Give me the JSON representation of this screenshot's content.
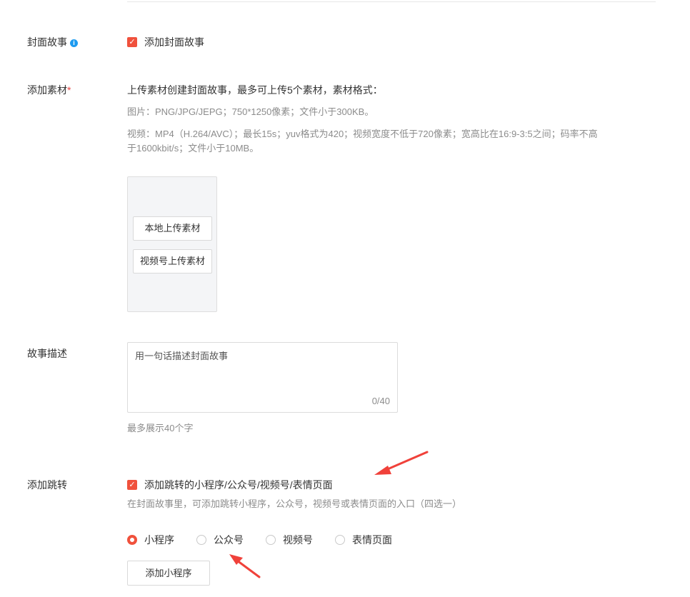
{
  "cover_story": {
    "label": "封面故事",
    "info_icon": "i",
    "checkbox_label": "添加封面故事",
    "checked": true
  },
  "material": {
    "label": "添加素材",
    "required_mark": "*",
    "desc_main": "上传素材创建封面故事，最多可上传5个素材，素材格式：",
    "desc_image": "图片：PNG/JPG/JEPG；750*1250像素；文件小于300KB。",
    "desc_video_line1": "视频：MP4（H.264/AVC）；最长15s；yuv格式为420；视频宽度不低于720像素；宽高比在16:9-3:5之间；码率不高",
    "desc_video_line2": "于1600kbit/s；文件小于10MB。",
    "upload_local": "本地上传素材",
    "upload_channels": "视频号上传素材"
  },
  "story_desc": {
    "label": "故事描述",
    "placeholder": "用一句话描述封面故事",
    "value": "",
    "counter": "0/40",
    "hint": "最多展示40个字"
  },
  "jump": {
    "label": "添加跳转",
    "checkbox_label": "添加跳转的小程序/公众号/视频号/表情页面",
    "checked": true,
    "hint": "在封面故事里，可添加跳转小程序，公众号，视频号或表情页面的入口（四选一）",
    "options": [
      "小程序",
      "公众号",
      "视频号",
      "表情页面"
    ],
    "selected": "小程序",
    "add_button": "添加小程序"
  },
  "colors": {
    "accent": "#f0513c",
    "info": "#1d9bf0",
    "arrow": "#f0413a"
  }
}
